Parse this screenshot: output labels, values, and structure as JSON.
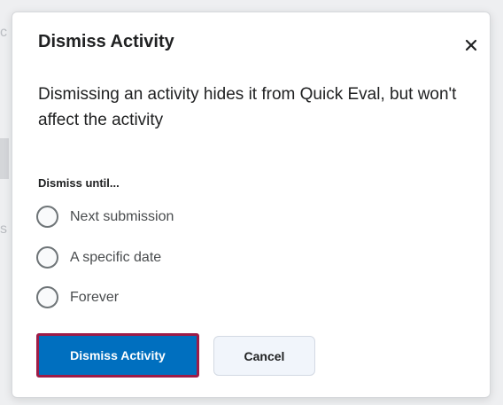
{
  "dialog": {
    "title": "Dismiss Activity",
    "close_icon": "close-icon",
    "description": "Dismissing an activity hides it from Quick Eval, but won't affect the activity",
    "group_label": "Dismiss until...",
    "options": [
      {
        "label": "Next submission",
        "selected": false
      },
      {
        "label": "A specific date",
        "selected": false
      },
      {
        "label": "Forever",
        "selected": false
      }
    ],
    "primary_button": "Dismiss Activity",
    "secondary_button": "Cancel"
  },
  "colors": {
    "primary": "#006fbf",
    "focus_ring": "#9d1c47",
    "text": "#202122"
  }
}
